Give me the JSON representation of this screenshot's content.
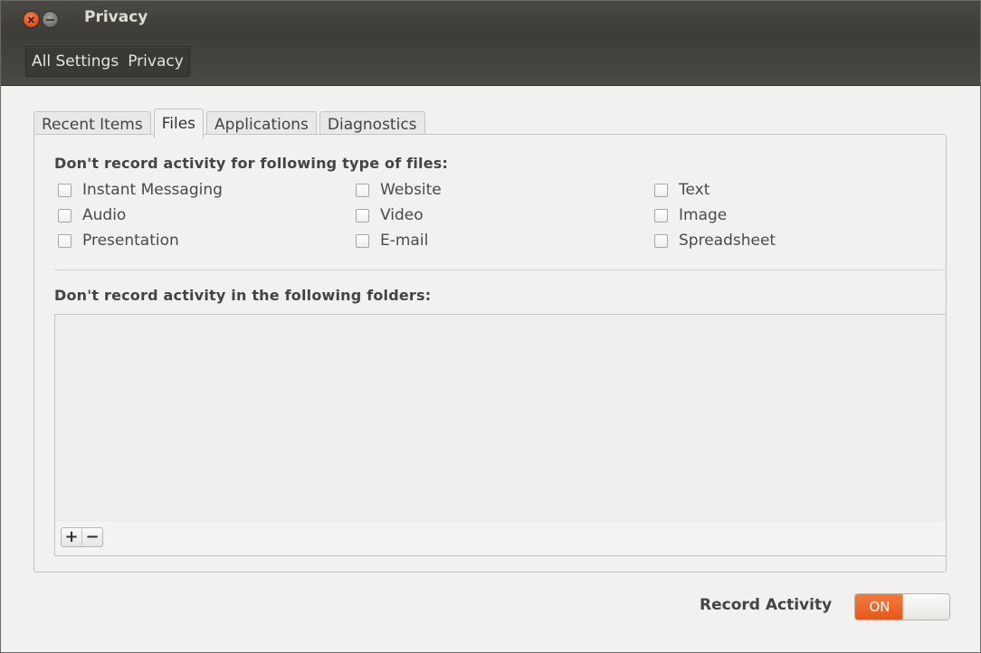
{
  "window": {
    "title": "Privacy"
  },
  "breadcrumb": [
    "All Settings",
    "Privacy"
  ],
  "tabs": [
    {
      "label": "Recent Items",
      "active": false
    },
    {
      "label": "Files",
      "active": true
    },
    {
      "label": "Applications",
      "active": false
    },
    {
      "label": "Diagnostics",
      "active": false
    }
  ],
  "files": {
    "types_heading": "Don't record activity for following type of files:",
    "types": [
      {
        "label": "Instant Messaging",
        "checked": false
      },
      {
        "label": "Website",
        "checked": false
      },
      {
        "label": "Text",
        "checked": false
      },
      {
        "label": "Audio",
        "checked": false
      },
      {
        "label": "Video",
        "checked": false
      },
      {
        "label": "Image",
        "checked": false
      },
      {
        "label": "Presentation",
        "checked": false
      },
      {
        "label": "E-mail",
        "checked": false
      },
      {
        "label": "Spreadsheet",
        "checked": false
      }
    ],
    "folders_heading": "Don't record activity in the following folders:",
    "folders": [],
    "add_label": "+",
    "remove_label": "−"
  },
  "record_activity": {
    "label": "Record Activity",
    "state_label": "ON",
    "enabled": true,
    "accent": "#e95a1f"
  }
}
